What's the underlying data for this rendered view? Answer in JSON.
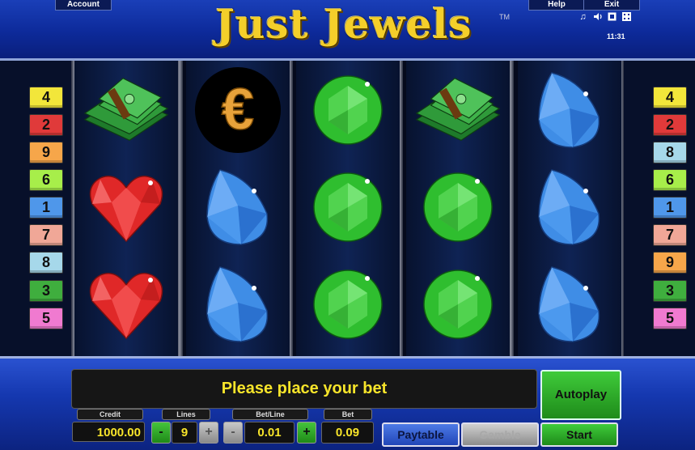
{
  "header": {
    "account_label": "Account",
    "help_label": "Help",
    "exit_label": "Exit",
    "logo_text": "Just Jewels",
    "trademark": "TM",
    "clock": "11:31",
    "icons": [
      "music-note-icon",
      "speaker-icon",
      "fullscreen-icon",
      "settings-grid-icon"
    ]
  },
  "lines_left": [
    {
      "num": "4",
      "color": "#f2e63a"
    },
    {
      "num": "2",
      "color": "#e03a3a"
    },
    {
      "num": "9",
      "color": "#f6a64a"
    },
    {
      "num": "6",
      "color": "#a7ee4a"
    },
    {
      "num": "1",
      "color": "#4f97ea"
    },
    {
      "num": "7",
      "color": "#f0a797"
    },
    {
      "num": "8",
      "color": "#a6d8ea"
    },
    {
      "num": "3",
      "color": "#3fae3e"
    },
    {
      "num": "5",
      "color": "#f07ad0"
    }
  ],
  "lines_right": [
    {
      "num": "4",
      "color": "#f2e63a"
    },
    {
      "num": "2",
      "color": "#e03a3a"
    },
    {
      "num": "8",
      "color": "#a6d8ea"
    },
    {
      "num": "6",
      "color": "#a7ee4a"
    },
    {
      "num": "1",
      "color": "#4f97ea"
    },
    {
      "num": "7",
      "color": "#f0a797"
    },
    {
      "num": "9",
      "color": "#f6a64a"
    },
    {
      "num": "3",
      "color": "#3fae3e"
    },
    {
      "num": "5",
      "color": "#f07ad0"
    }
  ],
  "reels": [
    [
      "money",
      "heart",
      "heart"
    ],
    [
      "euro",
      "sapphire",
      "sapphire"
    ],
    [
      "emerald",
      "emerald",
      "emerald"
    ],
    [
      "money",
      "emerald",
      "emerald"
    ],
    [
      "sapphire",
      "sapphire",
      "sapphire"
    ]
  ],
  "symbol_colors": {
    "heart": "#e02828",
    "sapphire": "#3f8de6",
    "emerald": "#2fbe2f",
    "money": "#2f9a3a",
    "euro": "#e8a23a"
  },
  "euro_glyph": "€",
  "controls": {
    "message": "Please place your bet",
    "autoplay_label": "Autoplay",
    "credit_label": "Credit",
    "credit_value": "1000.00",
    "lines_label": "Lines",
    "lines_value": "9",
    "betline_label": "Bet/Line",
    "betline_value": "0.01",
    "bet_label": "Bet",
    "bet_value": "0.09",
    "minus": "-",
    "plus": "+",
    "paytable_label": "Paytable",
    "gamble_label": "Gamble",
    "start_label": "Start"
  }
}
